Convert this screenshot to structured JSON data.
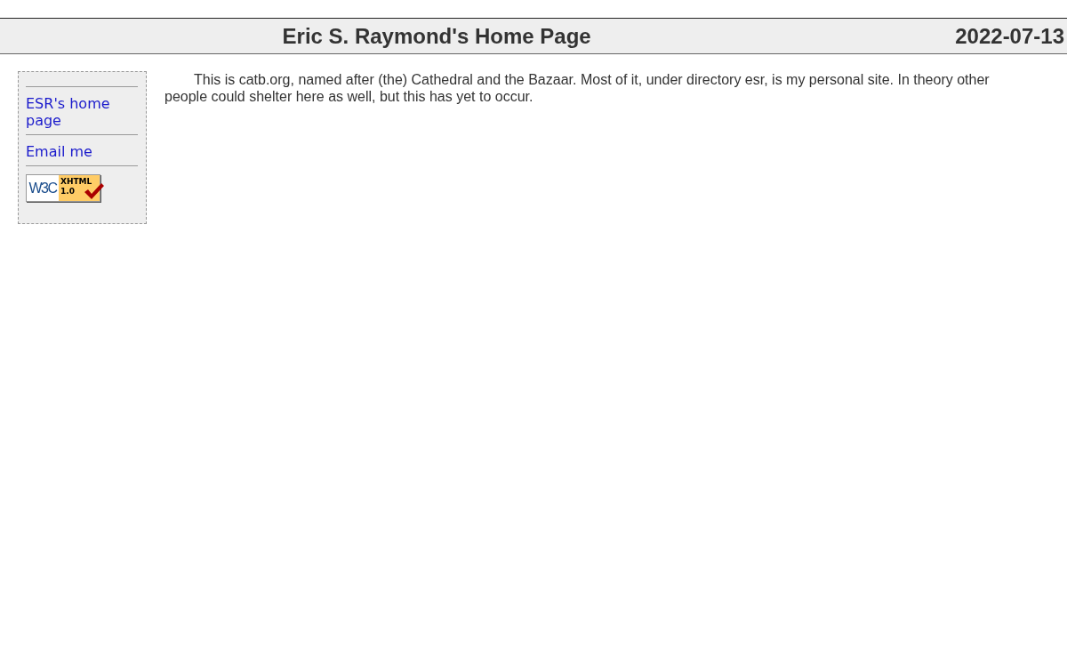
{
  "header": {
    "title": "Eric S. Raymond's Home Page",
    "date": "2022-07-13"
  },
  "sidebar": {
    "links": [
      "ESR's home page",
      "Email me"
    ],
    "badge": {
      "logo": "W3C",
      "label": "XHTML",
      "version": "1.0"
    }
  },
  "content": {
    "paragraph": "This is catb.org, named after (the) Cathedral and the Bazaar. Most of it, under directory esr, is my personal site. In theory other people could shelter here as well, but this has yet to occur."
  }
}
